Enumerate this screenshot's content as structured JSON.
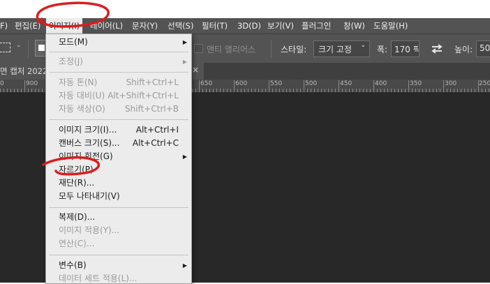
{
  "menubar": {
    "items": [
      "F)",
      "편집(E)",
      "이미지(I)",
      "레이어(L)",
      "문자(Y)",
      "선택(S)",
      "필터(T)",
      "3D(D)",
      "보기(V)",
      "플러그인",
      "창(W)",
      "도움말(H)"
    ]
  },
  "options": {
    "antialias_label": "앤티 앨리어스",
    "style_label": "스타일:",
    "style_value": "크기 고정",
    "width_label": "폭:",
    "width_value": "170 픽",
    "height_label": "높이:",
    "height_value": "50"
  },
  "document_tab": {
    "title": "면 캡처 2022"
  },
  "ruler": {
    "labels": [
      "0",
      "900",
      "650",
      "600",
      "550",
      "500",
      "450",
      "400",
      "350",
      "300",
      "250"
    ]
  },
  "image_menu": {
    "items": [
      {
        "label": "모드(M)",
        "shortcut": "",
        "submenu": true,
        "enabled": true
      },
      {
        "label": "조정(J)",
        "shortcut": "",
        "submenu": true,
        "enabled": false
      },
      {
        "label": "자동 톤(N)",
        "shortcut": "Shift+Ctrl+L",
        "submenu": false,
        "enabled": false
      },
      {
        "label": "자동 대비(U)",
        "shortcut": "Alt+Shift+Ctrl+L",
        "submenu": false,
        "enabled": false
      },
      {
        "label": "자동 색상(O)",
        "shortcut": "Shift+Ctrl+B",
        "submenu": false,
        "enabled": false
      },
      {
        "label": "이미지 크기(I)...",
        "shortcut": "Alt+Ctrl+I",
        "submenu": false,
        "enabled": true
      },
      {
        "label": "캔버스 크기(S)...",
        "shortcut": "Alt+Ctrl+C",
        "submenu": false,
        "enabled": true
      },
      {
        "label": "이미지 회전(G)",
        "shortcut": "",
        "submenu": true,
        "enabled": true
      },
      {
        "label": "자르기(P)",
        "shortcut": "",
        "submenu": false,
        "enabled": true
      },
      {
        "label": "재단(R)...",
        "shortcut": "",
        "submenu": false,
        "enabled": true
      },
      {
        "label": "모두 나타내기(V)",
        "shortcut": "",
        "submenu": false,
        "enabled": true
      },
      {
        "label": "복제(D)...",
        "shortcut": "",
        "submenu": false,
        "enabled": true
      },
      {
        "label": "이미지 적용(Y)...",
        "shortcut": "",
        "submenu": false,
        "enabled": false
      },
      {
        "label": "연산(C)...",
        "shortcut": "",
        "submenu": false,
        "enabled": false
      },
      {
        "label": "변수(B)",
        "shortcut": "",
        "submenu": true,
        "enabled": true
      },
      {
        "label": "데이터 세트 적용(L)...",
        "shortcut": "",
        "submenu": false,
        "enabled": false
      }
    ]
  },
  "colors": {
    "annotation": "#d81e1e",
    "menubar_bg": "#535353",
    "canvas_bg": "#282828"
  }
}
